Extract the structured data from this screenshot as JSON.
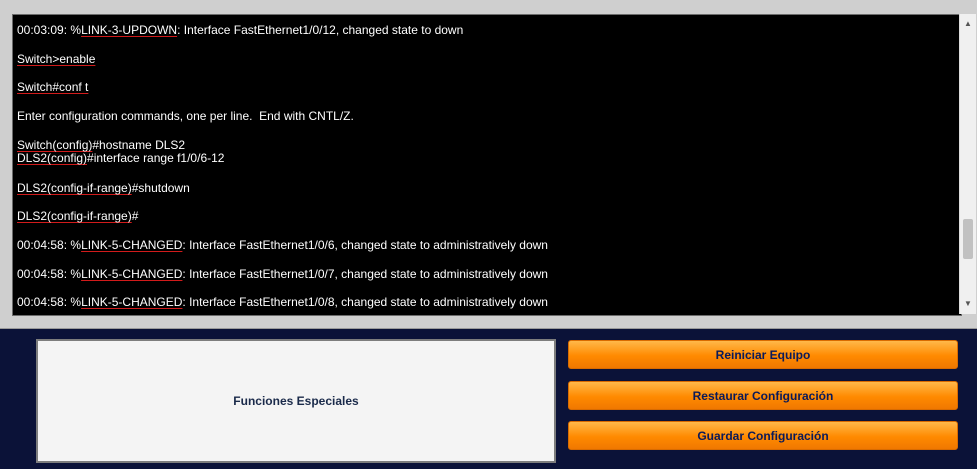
{
  "terminal": {
    "lines": [
      {
        "pre": "00:03:09: %",
        "mid": "LINK-3-UPDOWN",
        "post": ": Interface FastEthernet1/0/12, changed state to down"
      },
      {
        "pre": "",
        "mid": "Switch>enable",
        "post": ""
      },
      {
        "pre": "",
        "mid": "Switch#conf t",
        "post": ""
      },
      {
        "pre": "Enter configuration commands, one per line.  End with CNTL/Z.",
        "mid": "",
        "post": ""
      },
      {
        "pre": "",
        "mid": "Switch(config)",
        "post": "#hostname DLS2"
      },
      {
        "pre": "",
        "mid": "DLS2(config)",
        "post": "#interface range f1/0/6-12"
      },
      {
        "pre": "",
        "mid": "DLS2(config-if-range)",
        "post": "#shutdown"
      },
      {
        "pre": "",
        "mid": "DLS2(config-if-range)",
        "post": "#"
      },
      {
        "pre": "00:04:58: %",
        "mid": "LINK-5-CHANGED",
        "post": ": Interface FastEthernet1/0/6, changed state to administratively down"
      },
      {
        "pre": "00:04:58: %",
        "mid": "LINK-5-CHANGED",
        "post": ": Interface FastEthernet1/0/7, changed state to administratively down"
      },
      {
        "pre": "00:04:58: %",
        "mid": "LINK-5-CHANGED",
        "post": ": Interface FastEthernet1/0/8, changed state to administratively down"
      }
    ]
  },
  "panel": {
    "label": "Funciones Especiales"
  },
  "buttons": {
    "restart": "Reiniciar Equipo",
    "restore": "Restaurar Configuración",
    "save": "Guardar Configuración"
  },
  "scroll": {
    "up_icon": "scroll-up-arrow",
    "down_icon": "scroll-down-arrow"
  }
}
